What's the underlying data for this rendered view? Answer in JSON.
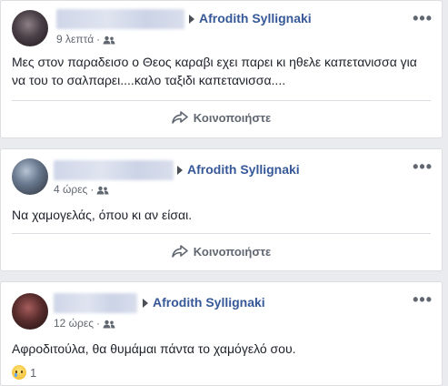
{
  "posts": [
    {
      "target_name": "Afrodith Syllignaki",
      "time": "9 λεπτά",
      "audience_icon": "friends-icon",
      "text": "Μες στον παραδεισο ο Θεος καραβι εχει παρει κι ηθελε καπετανισσα για να του το σαλπαρει....καλο ταξιδι καπετανισσα....",
      "share_label": "Κοινοποιήστε",
      "more_label": "•••"
    },
    {
      "target_name": "Afrodith Syllignaki",
      "time": "4 ώρες",
      "audience_icon": "friends-icon",
      "text": "Να χαμογελάς, όπου κι αν είσαι.",
      "share_label": "Κοινοποιήστε",
      "more_label": "•••"
    },
    {
      "target_name": "Afrodith Syllignaki",
      "time": "12 ώρες",
      "audience_icon": "friends-icon",
      "text": "Αφροδιτούλα, θα θυμάμαι πάντα το χαμόγελό σου.",
      "reaction_icon": "sad-reaction-icon",
      "reaction_count": "1",
      "more_label": "•••"
    }
  ],
  "colors": {
    "link": "#365899",
    "meta": "#616770",
    "text": "#1d2129",
    "background": "#e9ebee"
  }
}
